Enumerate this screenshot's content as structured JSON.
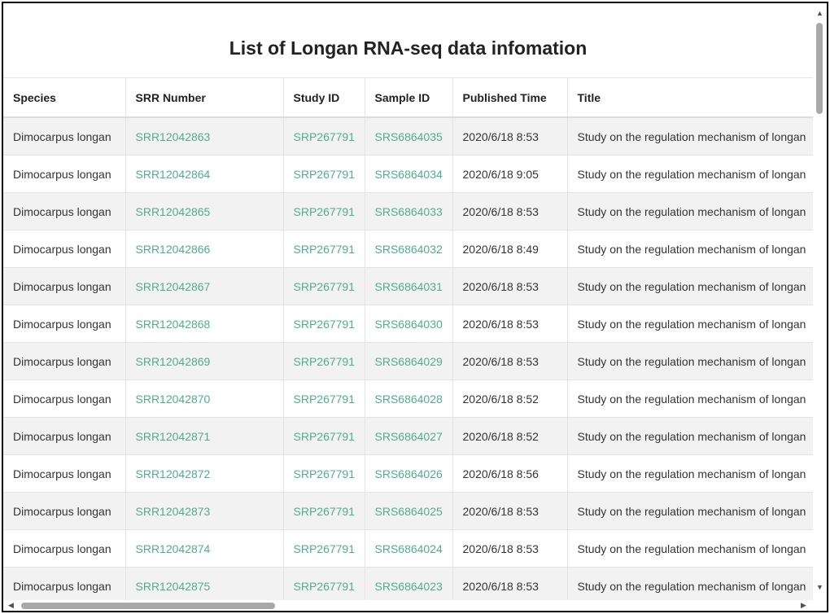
{
  "page": {
    "title": "List of Longan RNA-seq data infomation"
  },
  "table": {
    "headers": [
      "Species",
      "SRR Number",
      "Study ID",
      "Sample ID",
      "Published Time",
      "Title"
    ],
    "rows": [
      [
        "Dimocarpus longan",
        "SRR12042863",
        "SRP267791",
        "SRS6864035",
        "2020/6/18 8:53",
        "Study on the regulation mechanism of longan"
      ],
      [
        "Dimocarpus longan",
        "SRR12042864",
        "SRP267791",
        "SRS6864034",
        "2020/6/18 9:05",
        "Study on the regulation mechanism of longan"
      ],
      [
        "Dimocarpus longan",
        "SRR12042865",
        "SRP267791",
        "SRS6864033",
        "2020/6/18 8:53",
        "Study on the regulation mechanism of longan"
      ],
      [
        "Dimocarpus longan",
        "SRR12042866",
        "SRP267791",
        "SRS6864032",
        "2020/6/18 8:49",
        "Study on the regulation mechanism of longan"
      ],
      [
        "Dimocarpus longan",
        "SRR12042867",
        "SRP267791",
        "SRS6864031",
        "2020/6/18 8:53",
        "Study on the regulation mechanism of longan"
      ],
      [
        "Dimocarpus longan",
        "SRR12042868",
        "SRP267791",
        "SRS6864030",
        "2020/6/18 8:53",
        "Study on the regulation mechanism of longan"
      ],
      [
        "Dimocarpus longan",
        "SRR12042869",
        "SRP267791",
        "SRS6864029",
        "2020/6/18 8:53",
        "Study on the regulation mechanism of longan"
      ],
      [
        "Dimocarpus longan",
        "SRR12042870",
        "SRP267791",
        "SRS6864028",
        "2020/6/18 8:52",
        "Study on the regulation mechanism of longan"
      ],
      [
        "Dimocarpus longan",
        "SRR12042871",
        "SRP267791",
        "SRS6864027",
        "2020/6/18 8:52",
        "Study on the regulation mechanism of longan"
      ],
      [
        "Dimocarpus longan",
        "SRR12042872",
        "SRP267791",
        "SRS6864026",
        "2020/6/18 8:56",
        "Study on the regulation mechanism of longan"
      ],
      [
        "Dimocarpus longan",
        "SRR12042873",
        "SRP267791",
        "SRS6864025",
        "2020/6/18 8:53",
        "Study on the regulation mechanism of longan"
      ],
      [
        "Dimocarpus longan",
        "SRR12042874",
        "SRP267791",
        "SRS6864024",
        "2020/6/18 8:53",
        "Study on the regulation mechanism of longan"
      ],
      [
        "Dimocarpus longan",
        "SRR12042875",
        "SRP267791",
        "SRS6864023",
        "2020/6/18 8:53",
        "Study on the regulation mechanism of longan"
      ]
    ]
  },
  "colors": {
    "link": "#4fae8a",
    "row_alt": "#f2f2f2",
    "border": "#e4e4e4"
  },
  "icons": {
    "scroll_up": "triangle-up",
    "scroll_down": "triangle-down",
    "scroll_left": "triangle-left",
    "scroll_right": "triangle-right"
  }
}
